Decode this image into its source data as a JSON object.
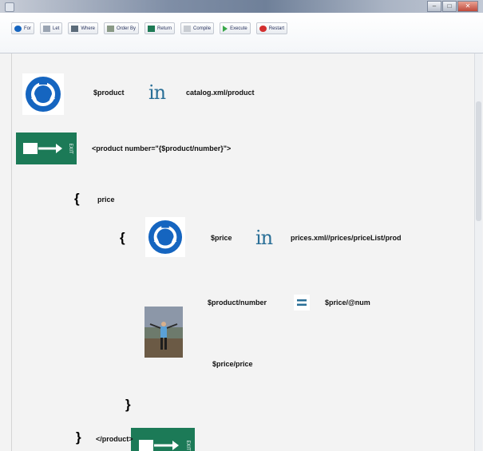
{
  "toolbar": {
    "buttons": [
      {
        "label": "For",
        "icon": "roundabout-icon"
      },
      {
        "label": "Let",
        "icon": "let-icon"
      },
      {
        "label": "Where",
        "icon": "where-icon"
      },
      {
        "label": "Order By",
        "icon": "order-by-icon"
      },
      {
        "label": "Return",
        "icon": "exit-sign-icon"
      },
      {
        "label": "Compile",
        "icon": "compile-icon"
      },
      {
        "label": "Execute",
        "icon": "play-icon"
      },
      {
        "label": "Restart",
        "icon": "restart-icon"
      }
    ]
  },
  "program": {
    "for1": {
      "var": "$product",
      "keyword": "in",
      "source": "catalog.xml/product"
    },
    "return1": {
      "text": "<product number=\"{$product/number}\">"
    },
    "open_brace1": "{",
    "element_name": "price",
    "open_brace2": "{",
    "for2": {
      "var": "$price",
      "keyword": "in",
      "source": "prices.xml//prices/priceList/prod"
    },
    "where": {
      "left": "$product/number",
      "op": "=",
      "right": "$price/@num"
    },
    "return2": {
      "text": "$price/price"
    },
    "close_brace2": "}",
    "close_brace1": "}",
    "closing_tag": "</product>"
  },
  "exit_sign_label": "EXIT",
  "colors": {
    "roundabout_blue": "#1565c0",
    "exit_green": "#1c7a57",
    "in_glyph": "#2a6f97"
  }
}
